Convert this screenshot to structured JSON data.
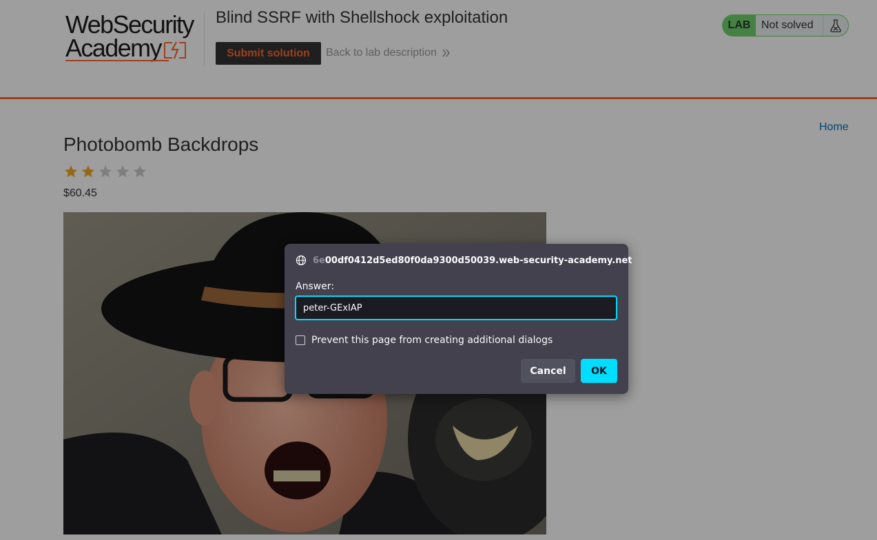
{
  "header": {
    "logo_line1": "WebSecurity",
    "logo_line2": "Academy",
    "lab_title": "Blind SSRF with Shellshock exploitation",
    "submit_label": "Submit solution",
    "back_label": "Back to lab description",
    "status_badge": "LAB",
    "status_text": "Not solved"
  },
  "nav": {
    "home_label": "Home"
  },
  "product": {
    "title": "Photobomb Backdrops",
    "rating": 2,
    "rating_max": 5,
    "price": "$60.45"
  },
  "dialog": {
    "origin_faded": "6e",
    "origin_main": "00df0412d5ed80f0da9300d50039.web-security-academy.net",
    "prompt_label": "Answer:",
    "input_value": "peter-GExIAP",
    "checkbox_label": "Prevent this page from creating additional dialogs",
    "checkbox_checked": false,
    "cancel_label": "Cancel",
    "ok_label": "OK"
  },
  "colors": {
    "accent": "#ff6633",
    "lab_green": "#70d16d",
    "link_blue": "#0071bc",
    "dialog_bg": "#42414d",
    "dialog_focus": "#00ddff",
    "star_filled": "#f5a623",
    "star_empty": "#cccccc"
  },
  "icons": {
    "logo_mark": "lightning-bolt-icon",
    "back_chevron": "double-chevron-right-icon",
    "flask": "flask-icon",
    "globe": "globe-icon",
    "star": "star-icon"
  }
}
